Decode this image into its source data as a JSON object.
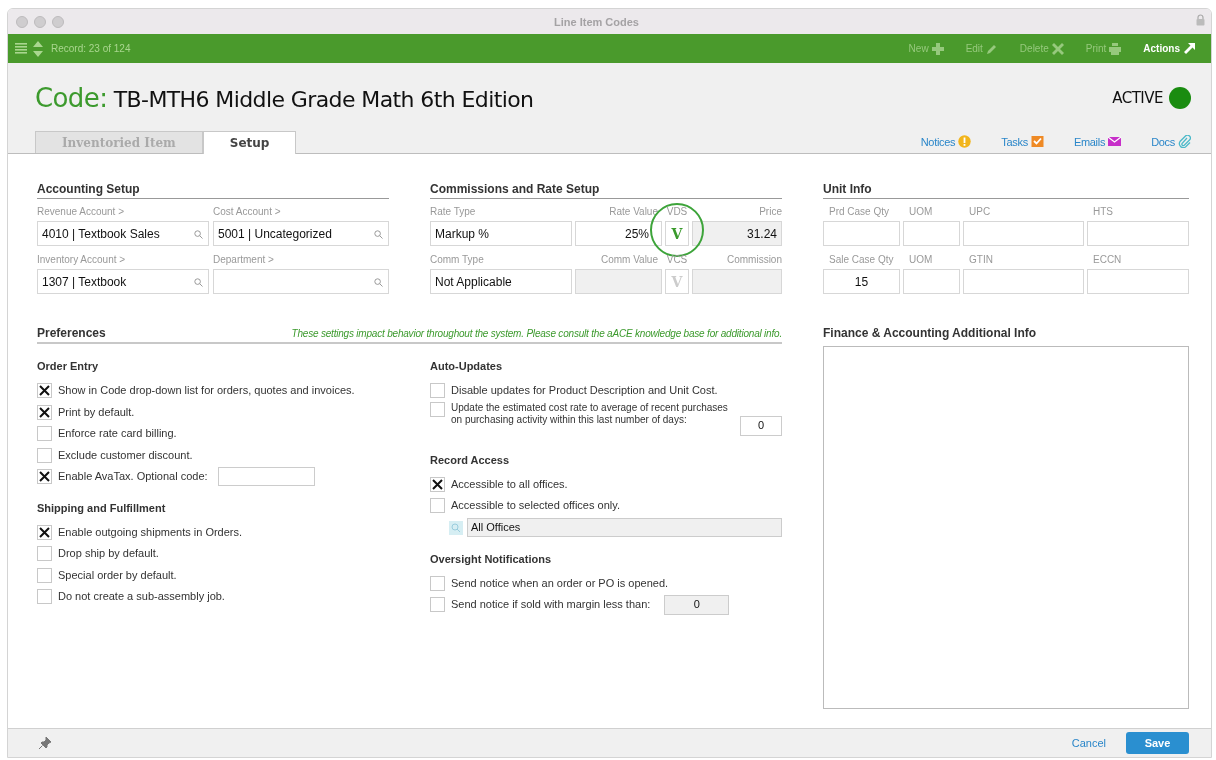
{
  "window": {
    "title": "Line Item Codes"
  },
  "toolbar": {
    "record": "Record: 23 of 124",
    "actions": [
      {
        "kind": "new",
        "label": "New",
        "disabled": true
      },
      {
        "kind": "edit",
        "label": "Edit",
        "disabled": true
      },
      {
        "kind": "delete",
        "label": "Delete",
        "disabled": true
      },
      {
        "kind": "print",
        "label": "Print",
        "disabled": true
      },
      {
        "kind": "actions",
        "label": "Actions",
        "disabled": false
      }
    ]
  },
  "header": {
    "code_label": "Code:",
    "code_value": "TB-MTH6 Middle Grade Math 6th Edition",
    "status": "ACTIVE"
  },
  "tabs": [
    {
      "label": "Inventoried Item",
      "selected": false
    },
    {
      "label": "Setup",
      "selected": true
    }
  ],
  "links": [
    {
      "kind": "notices",
      "label": "Notices"
    },
    {
      "kind": "tasks",
      "label": "Tasks"
    },
    {
      "kind": "emails",
      "label": "Emails"
    },
    {
      "kind": "docs",
      "label": "Docs"
    }
  ],
  "accounting": {
    "title": "Accounting Setup",
    "fields": [
      {
        "label": "Revenue Account >",
        "value": "4010 | Textbook Sales"
      },
      {
        "label": "Cost Account >",
        "value": "5001 | Uncategorized"
      },
      {
        "label": "Inventory Account >",
        "value": "1307 | Textbook"
      },
      {
        "label": "Department >"
      }
    ]
  },
  "commissions": {
    "title": "Commissions and Rate Setup",
    "rows": [
      {
        "type_label": "Rate Type",
        "type_value": "Markup %",
        "value_label": "Rate Value",
        "value": "25%",
        "flag_label": "VDS",
        "flag": "V",
        "flag_on": true,
        "total_label": "Price",
        "total": "31.24",
        "circled": true
      },
      {
        "type_label": "Comm Type",
        "type_value": "Not Applicable",
        "value_label": "Comm Value",
        "flag_label": "VCS",
        "flag": "V",
        "flag_on": false,
        "total_label": "Commission"
      }
    ]
  },
  "unit_info": {
    "title": "Unit Info",
    "rows": [
      {
        "fields": [
          {
            "label": "Prd Case Qty"
          },
          {
            "label": "UOM"
          },
          {
            "label": "UPC"
          },
          {
            "label": "HTS"
          }
        ]
      },
      {
        "fields": [
          {
            "label": "Sale Case Qty",
            "value": "15"
          },
          {
            "label": "UOM"
          },
          {
            "label": "GTIN"
          },
          {
            "label": "ECCN"
          }
        ]
      }
    ]
  },
  "preferences": {
    "title": "Preferences",
    "note": "These settings impact behavior throughout the system. Please consult the aACE knowledge base for additional info.",
    "columns": [
      {
        "groups": [
          {
            "title": "Order Entry",
            "items": [
              {
                "kind": "check",
                "label": "Show in Code drop-down list for orders, quotes and invoices.",
                "checked": true
              },
              {
                "kind": "check",
                "label": "Print by default.",
                "checked": true
              },
              {
                "kind": "check",
                "label": "Enforce rate card billing.",
                "checked": false
              },
              {
                "kind": "check",
                "label": "Exclude customer discount.",
                "checked": false
              },
              {
                "kind": "check-field",
                "label": "Enable AvaTax. Optional code:",
                "checked": true
              }
            ]
          },
          {
            "title": "Shipping and Fulfillment",
            "items": [
              {
                "kind": "check",
                "label": "Enable outgoing shipments in Orders.",
                "checked": true
              },
              {
                "kind": "check",
                "label": "Drop ship by default.",
                "checked": false
              },
              {
                "kind": "check",
                "label": "Special order by default.",
                "checked": false
              },
              {
                "kind": "check",
                "label": "Do not create a sub-assembly job.",
                "checked": false
              }
            ]
          }
        ]
      },
      {
        "groups": [
          {
            "title": "Auto-Updates",
            "items": [
              {
                "kind": "check",
                "label": "Disable updates for Product Description and Unit Cost.",
                "checked": false
              },
              {
                "kind": "check-number",
                "label": "Update the estimated cost rate to average of recent purchases on purchasing activity within this last number of days:",
                "checked": false,
                "value": "0",
                "field_disabled": false
              }
            ]
          },
          {
            "title": "Record Access",
            "items": [
              {
                "kind": "check",
                "label": "Accessible to all offices.",
                "checked": true
              },
              {
                "kind": "check",
                "label": "Accessible to selected offices only.",
                "checked": false
              },
              {
                "kind": "lookup",
                "value": "All Offices"
              }
            ]
          },
          {
            "title": "Oversight Notifications",
            "items": [
              {
                "kind": "check",
                "label": "Send notice when an order or PO is opened.",
                "checked": false
              },
              {
                "kind": "check-number",
                "label": "Send notice if sold with margin less than:",
                "checked": false,
                "value": "0",
                "field_disabled": true
              }
            ]
          }
        ]
      }
    ]
  },
  "finance": {
    "title": "Finance & Accounting Additional Info"
  },
  "footer": {
    "cancel": "Cancel",
    "save": "Save"
  }
}
